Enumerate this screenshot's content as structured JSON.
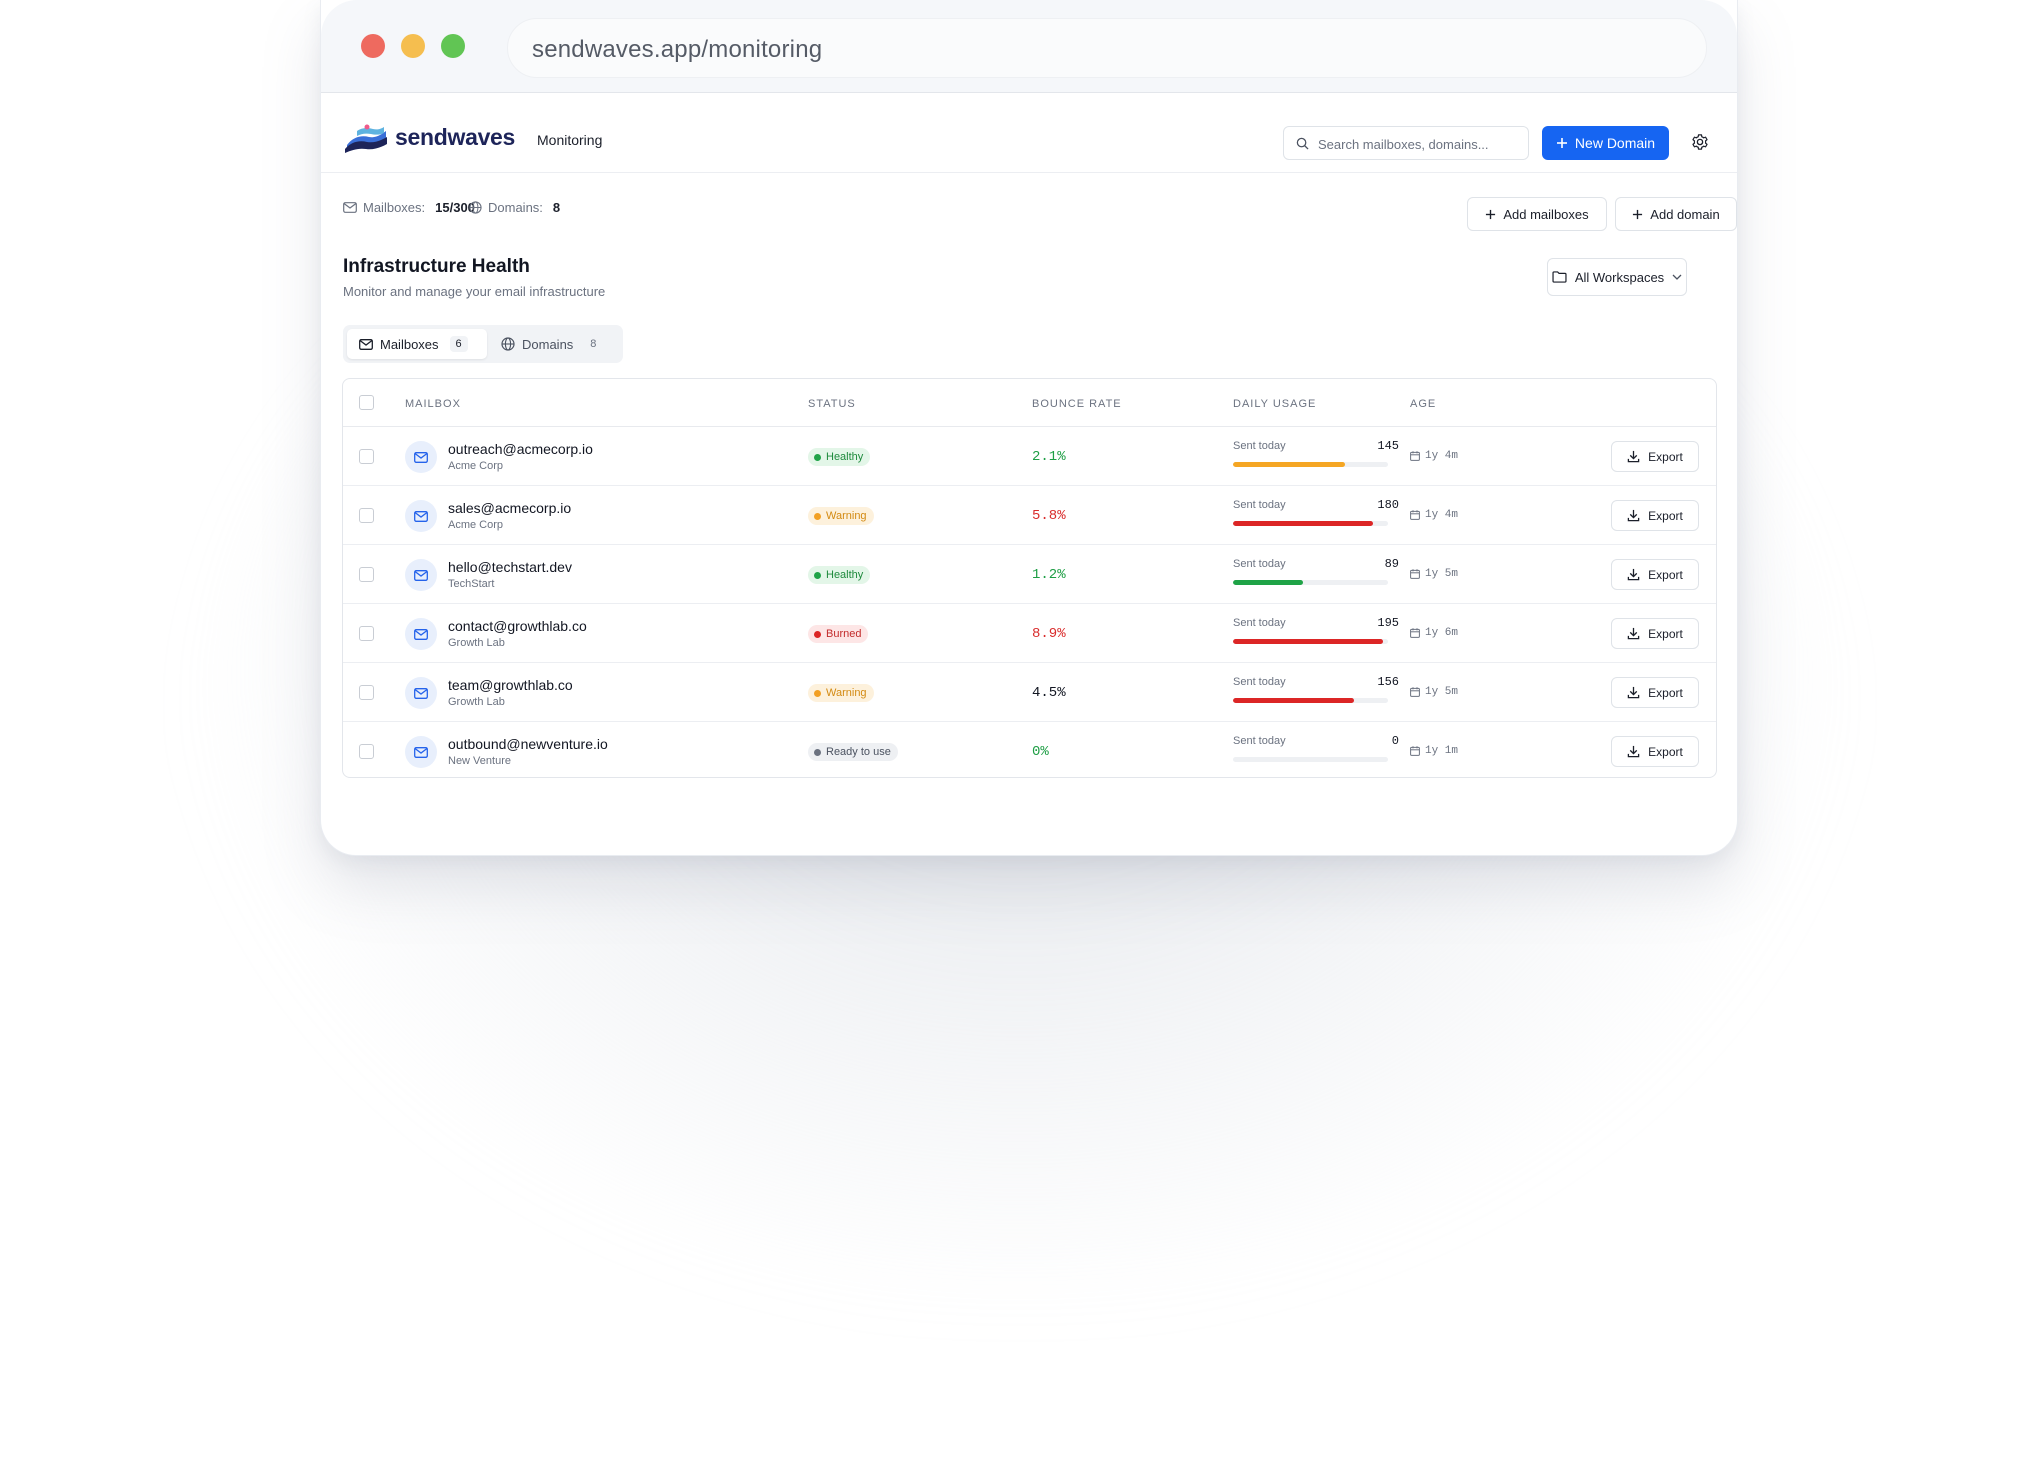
{
  "browser": {
    "url": "sendwaves.app/monitoring"
  },
  "header": {
    "brand": "sendwaves",
    "nav_item": "Monitoring",
    "search_placeholder": "Search mailboxes, domains...",
    "new_domain_label": "New Domain"
  },
  "stats": {
    "mailboxes_label": "Mailboxes:",
    "mailboxes_value": "15/300",
    "domains_label": "Domains:",
    "domains_value": "8",
    "add_mailboxes_label": "Add mailboxes",
    "add_domain_label": "Add domain"
  },
  "page": {
    "title": "Infrastructure Health",
    "subtitle": "Monitor and manage your email infrastructure",
    "workspace_label": "All Workspaces"
  },
  "tabs": [
    {
      "label": "Mailboxes",
      "count": "6"
    },
    {
      "label": "Domains",
      "count": "8"
    }
  ],
  "table": {
    "columns": [
      "MAILBOX",
      "STATUS",
      "BOUNCE RATE",
      "DAILY USAGE",
      "AGE"
    ],
    "usage_label": "Sent today",
    "export_label": "Export",
    "rows": [
      {
        "email": "outreach@acmecorp.io",
        "org": "Acme Corp",
        "status": "Healthy",
        "status_kind": "healthy",
        "bounce": "2.1%",
        "bounce_color": "green",
        "sent": "145",
        "usage_fraction": 0.72,
        "usage_color": "#f5a623",
        "age": "1y 4m"
      },
      {
        "email": "sales@acmecorp.io",
        "org": "Acme Corp",
        "status": "Warning",
        "status_kind": "warning",
        "bounce": "5.8%",
        "bounce_color": "red",
        "sent": "180",
        "usage_fraction": 0.9,
        "usage_color": "#dc2626",
        "age": "1y 4m"
      },
      {
        "email": "hello@techstart.dev",
        "org": "TechStart",
        "status": "Healthy",
        "status_kind": "healthy",
        "bounce": "1.2%",
        "bounce_color": "green",
        "sent": "89",
        "usage_fraction": 0.45,
        "usage_color": "#1fa347",
        "age": "1y 5m"
      },
      {
        "email": "contact@growthlab.co",
        "org": "Growth Lab",
        "status": "Burned",
        "status_kind": "burned",
        "bounce": "8.9%",
        "bounce_color": "red",
        "sent": "195",
        "usage_fraction": 0.97,
        "usage_color": "#dc2626",
        "age": "1y 6m"
      },
      {
        "email": "team@growthlab.co",
        "org": "Growth Lab",
        "status": "Warning",
        "status_kind": "warning",
        "bounce": "4.5%",
        "bounce_color": "dark",
        "sent": "156",
        "usage_fraction": 0.78,
        "usage_color": "#dc2626",
        "age": "1y 5m"
      },
      {
        "email": "outbound@newventure.io",
        "org": "New Venture",
        "status": "Ready to use",
        "status_kind": "ready",
        "bounce": "0%",
        "bounce_color": "green",
        "sent": "0",
        "usage_fraction": 0,
        "usage_color": "#dc2626",
        "age": "1y 1m"
      }
    ]
  },
  "colors": {
    "primary": "#1665f2",
    "brand_navy": "#1d2459"
  },
  "icons": [
    "mail-icon",
    "globe-icon",
    "search-icon",
    "gear-icon",
    "plus-icon",
    "folder-icon",
    "chevron-down-icon",
    "calendar-icon",
    "download-icon"
  ]
}
